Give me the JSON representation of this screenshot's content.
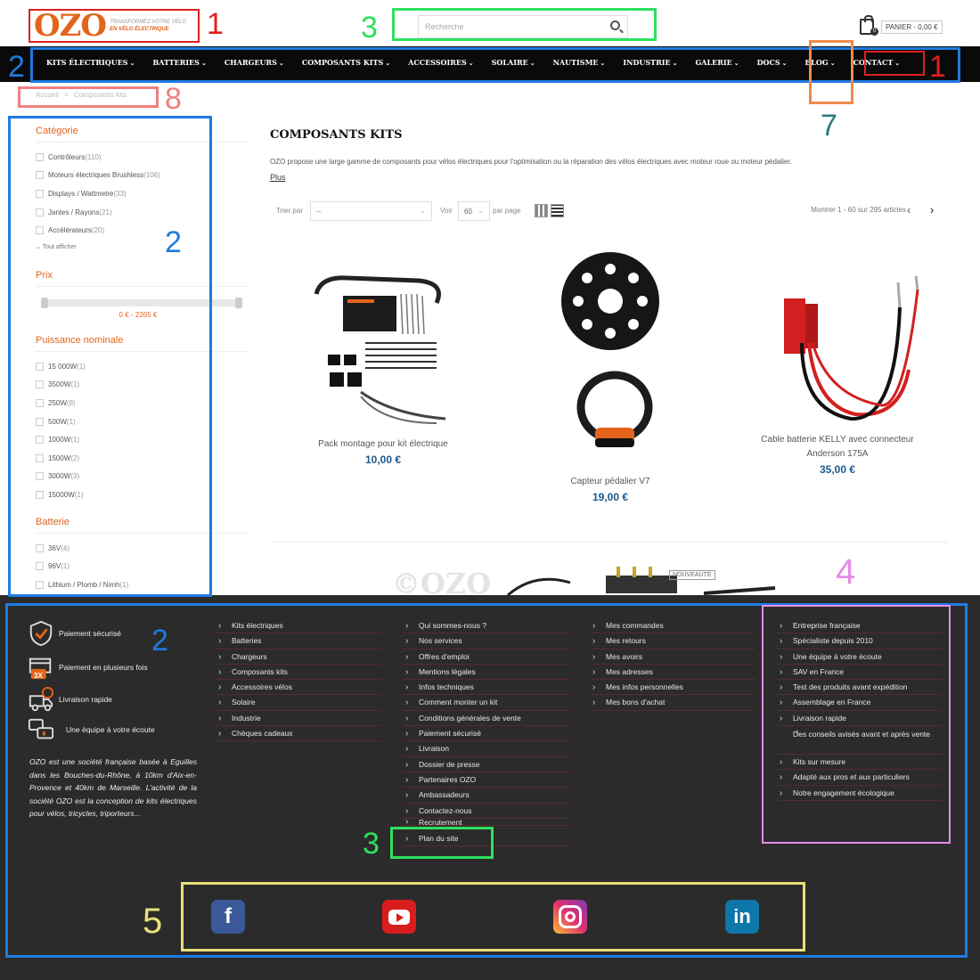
{
  "header": {
    "logo_text": "OZO",
    "logo_tagline_1": "TRANSFORMEZ VOTRE VÉLO",
    "logo_tagline_2": "EN VÉLO ÉLECTRIQUE",
    "search_placeholder": "Recherche",
    "cart_count": "0",
    "cart_label": "PANIER - 0,00 €"
  },
  "nav": {
    "items": [
      "KITS ÉLECTRIQUES",
      "BATTERIES",
      "CHARGEURS",
      "COMPOSANTS KITS",
      "ACCESSOIRES",
      "SOLAIRE",
      "NAUTISME",
      "INDUSTRIE",
      "GALERIE",
      "DOCS",
      "BLOG",
      "CONTACT"
    ]
  },
  "breadcrumb": {
    "home": "Accueil",
    "sep": ">",
    "current": "Composants kits"
  },
  "sidebar": {
    "category_title": "Catégorie",
    "categories": [
      {
        "label": "Contrôleurs",
        "count": "(110)"
      },
      {
        "label": "Moteurs électriques Brushless",
        "count": "(106)"
      },
      {
        "label": "Displays / Wattmetre",
        "count": "(33)"
      },
      {
        "label": "Jantes / Rayons",
        "count": "(21)"
      },
      {
        "label": "Accélérateurs",
        "count": "(20)"
      }
    ],
    "show_all": "Tout afficher",
    "price_title": "Prix",
    "price_range": "0 € - 2205 €",
    "power_title": "Puissance nominale",
    "powers": [
      {
        "label": "15 000W",
        "count": "(1)"
      },
      {
        "label": "3500W",
        "count": "(1)"
      },
      {
        "label": "250W",
        "count": "(8)"
      },
      {
        "label": "500W",
        "count": "(1)"
      },
      {
        "label": "1000W",
        "count": "(1)"
      },
      {
        "label": "1500W",
        "count": "(2)"
      },
      {
        "label": "3000W",
        "count": "(3)"
      },
      {
        "label": "15000W",
        "count": "(1)"
      }
    ],
    "battery_title": "Batterie",
    "batteries": [
      {
        "label": "36V",
        "count": "(4)"
      },
      {
        "label": "96V",
        "count": "(1)"
      },
      {
        "label": "Lithium / Plomb / Nimh",
        "count": "(1)"
      }
    ]
  },
  "main": {
    "title": "COMPOSANTS KITS",
    "intro": "OZO propose une large gamme de composants pour vélos électriques pour l'optimisation ou la réparation des vélos électriques avec moteur roue ou moteur pédalier.",
    "more": "Plus",
    "sort_label": "Trier par",
    "sort_value": "--",
    "show_label": "Voir",
    "per_page_value": "60",
    "per_page_label": "par page",
    "pager_text": "Montrer 1 - 60 sur 295 articles",
    "products": [
      {
        "name": "Pack montage pour kit électrique",
        "price": "10,00 €"
      },
      {
        "name": "Capteur pédalier V7",
        "price": "19,00 €"
      },
      {
        "name": "Cable batterie KELLY avec connecteur Anderson 175A",
        "price": "35,00 €"
      }
    ],
    "watermark": "©OZO",
    "new_badge": "NOUVEAUTÉ"
  },
  "footer": {
    "features": [
      "Paiement sécurisé",
      "Paiement en plusieurs fois",
      "Livraison rapide",
      "Une équipe à votre écoute"
    ],
    "feature_badge": "3X",
    "about": "OZO est une société française basée à Eguilles dans les Bouches-du-Rhône, à 10km d'Aix-en-Provence et 40km de Marseille. L'activité de la société OZO est la conception de kits électriques pour vélos, tricycles, triporteurs...",
    "col1": [
      "Kits électriques",
      "Batteries",
      "Chargeurs",
      "Composants kits",
      "Accessoires vélos",
      "Solaire",
      "Industrie",
      "Chèques cadeaux"
    ],
    "col2": [
      "Qui sommes-nous ?",
      "Nos services",
      "Offres d'emploi",
      "Mentions légales",
      "Infos techniques",
      "Comment monter un kit",
      "Conditions générales de vente",
      "Paiement sécurisé",
      "Livraison",
      "Dossier de presse",
      "Partenaires OZO",
      "Ambassadeurs",
      "Contactez-nous",
      "Recrutement",
      "Plan du site"
    ],
    "col3": [
      "Mes commandes",
      "Mes retours",
      "Mes avoirs",
      "Mes adresses",
      "Mes infos personnelles",
      "Mes bons d'achat"
    ],
    "col4": [
      "Entreprise française",
      "Spécialiste depuis 2010",
      "Une équipe à votre écoute",
      "SAV en France",
      "Test des produits avant expédition",
      "Assemblage en France",
      "Livraison rapide",
      "Des conseils avisés avant et après vente",
      "Kits sur mesure",
      "Adapté aux pros et aux particuliers",
      "Notre engagement écologique"
    ],
    "social": [
      "facebook",
      "youtube",
      "instagram",
      "linkedin"
    ],
    "social_letters": {
      "facebook": "f",
      "linkedin": "in"
    }
  },
  "annotations": [
    "1",
    "2",
    "3",
    "1",
    "8",
    "7",
    "2",
    "4",
    "2",
    "3",
    "5"
  ],
  "colors": {
    "accent": "#e3641b",
    "price": "#1c5a8e",
    "nav_bg": "#0a0a0a",
    "footer_bg": "#2b2b2b",
    "ann_red": "#e02020",
    "ann_blue": "#1e7be0",
    "ann_green": "#2ee060",
    "ann_orange": "#f08a4b",
    "ann_pink": "#f08080",
    "ann_teal": "#2b7a78",
    "ann_violet": "#e58be8",
    "ann_yellow": "#e8e07a"
  }
}
